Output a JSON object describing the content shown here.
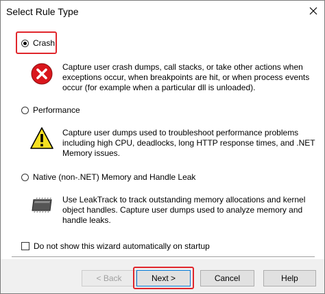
{
  "window": {
    "title": "Select Rule Type"
  },
  "options": [
    {
      "label": "Crash",
      "checked": true,
      "description": "Capture user crash dumps, call stacks, or take other actions when exceptions occur, when breakpoints are hit, or when process events occur (for example when a particular dll is unloaded).",
      "icon": "error-icon"
    },
    {
      "label": "Performance",
      "checked": false,
      "description": "Capture user dumps used to troubleshoot performance problems including high CPU, deadlocks, long HTTP response times, and .NET Memory issues.",
      "icon": "warning-icon"
    },
    {
      "label": "Native (non-.NET) Memory and Handle Leak",
      "checked": false,
      "description": "Use LeakTrack to track outstanding memory allocations and kernel object handles. Capture user dumps used to analyze memory and handle leaks.",
      "icon": "memory-chip-icon"
    }
  ],
  "startup_checkbox": {
    "label": "Do not show this wizard automatically on startup",
    "checked": false
  },
  "buttons": {
    "back": "< Back",
    "next": "Next >",
    "cancel": "Cancel",
    "help": "Help"
  },
  "colors": {
    "highlight": "#e0252b",
    "error": "#d9161c",
    "warning": "#f5e021"
  }
}
